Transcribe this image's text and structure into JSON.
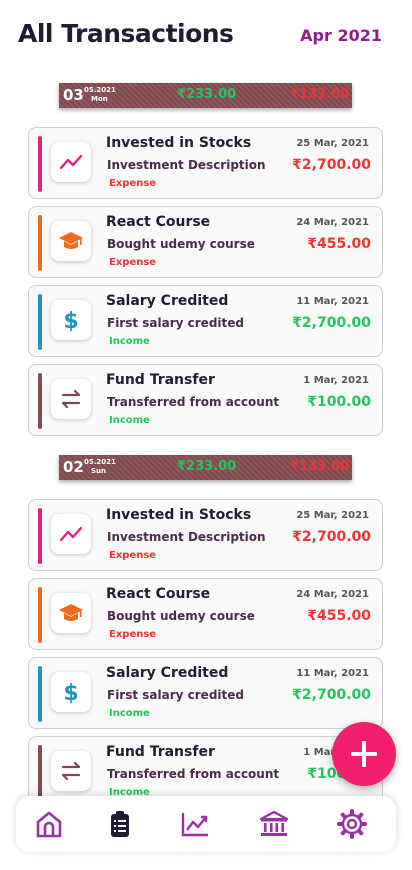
{
  "header": {
    "title": "All Transactions",
    "month": "Apr 2021"
  },
  "colors": {
    "primary": "#8b1e8c",
    "income": "#22c55e",
    "expense": "#ef3434",
    "fab": "#f0206e"
  },
  "days": [
    {
      "day": "03",
      "date": "05.2021",
      "dow": "Mon",
      "income": "₹233.00",
      "expense": "₹133.00",
      "transactions": [
        {
          "title": "Invested in Stocks",
          "description": "Investment Description",
          "type": "Expense",
          "date": "25 Mar, 2021",
          "amount": "₹2,700.00",
          "icon": "trending-up-icon",
          "accent": "#e91e7a"
        },
        {
          "title": "React Course",
          "description": "Bought udemy course",
          "type": "Expense",
          "date": "24 Mar, 2021",
          "amount": "₹455.00",
          "icon": "graduation-cap-icon",
          "accent": "#f26b1d"
        },
        {
          "title": "Salary Credited",
          "description": "First salary credited",
          "type": "Income",
          "date": "11 Mar, 2021",
          "amount": "₹2,700.00",
          "icon": "dollar-icon",
          "accent": "#1f97c2"
        },
        {
          "title": "Fund Transfer",
          "description": "Transferred from account",
          "type": "Income",
          "date": "1 Mar, 2021",
          "amount": "₹100.00",
          "icon": "transfer-icon",
          "accent": "#7e4a4f"
        }
      ]
    },
    {
      "day": "02",
      "date": "05.2021",
      "dow": "Sun",
      "income": "₹233.00",
      "expense": "₹133.00",
      "transactions": [
        {
          "title": "Invested in Stocks",
          "description": "Investment Description",
          "type": "Expense",
          "date": "25 Mar, 2021",
          "amount": "₹2,700.00",
          "icon": "trending-up-icon",
          "accent": "#e91e7a"
        },
        {
          "title": "React Course",
          "description": "Bought udemy course",
          "type": "Expense",
          "date": "24 Mar, 2021",
          "amount": "₹455.00",
          "icon": "graduation-cap-icon",
          "accent": "#f26b1d"
        },
        {
          "title": "Salary Credited",
          "description": "First salary credited",
          "type": "Income",
          "date": "11 Mar, 2021",
          "amount": "₹2,700.00",
          "icon": "dollar-icon",
          "accent": "#1f97c2"
        },
        {
          "title": "Fund Transfer",
          "description": "Transferred from account",
          "type": "Income",
          "date": "1 Mar, 2021",
          "amount": "₹100.00",
          "icon": "transfer-icon",
          "accent": "#7e4a4f"
        }
      ]
    }
  ],
  "nav": {
    "items": [
      {
        "name": "home-icon"
      },
      {
        "name": "transactions-clipboard-icon",
        "active": true
      },
      {
        "name": "analytics-chart-icon"
      },
      {
        "name": "bank-icon"
      },
      {
        "name": "settings-gear-icon"
      }
    ]
  },
  "fab": {
    "icon": "plus-icon"
  }
}
